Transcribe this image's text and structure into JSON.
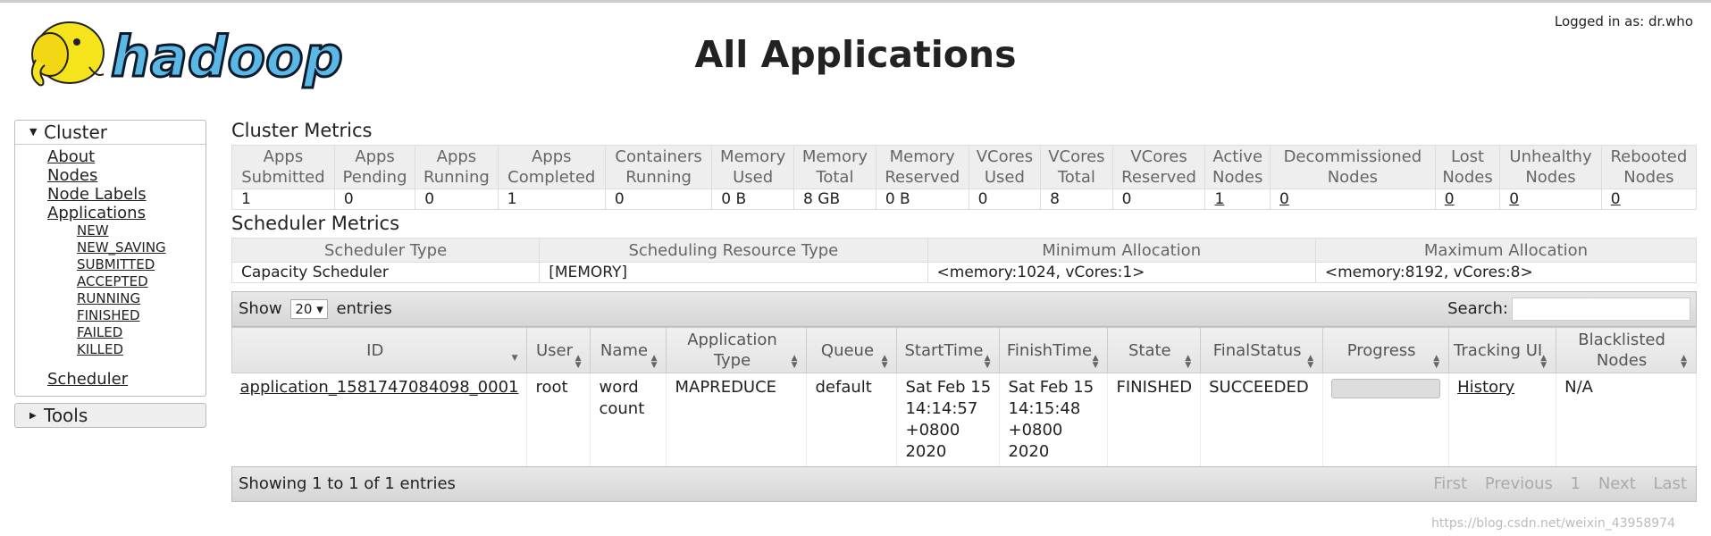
{
  "header": {
    "title": "All Applications",
    "login": "Logged in as: dr.who",
    "logo_text": "hadoop"
  },
  "sidebar": {
    "cluster_label": "Cluster",
    "links": [
      "About",
      "Nodes",
      "Node Labels",
      "Applications"
    ],
    "app_states": [
      "NEW",
      "NEW_SAVING",
      "SUBMITTED",
      "ACCEPTED",
      "RUNNING",
      "FINISHED",
      "FAILED",
      "KILLED"
    ],
    "scheduler": "Scheduler",
    "tools_label": "Tools"
  },
  "cluster_metrics": {
    "title": "Cluster Metrics",
    "headers": [
      [
        "Apps",
        "Submitted"
      ],
      [
        "Apps",
        "Pending"
      ],
      [
        "Apps",
        "Running"
      ],
      [
        "Apps",
        "Completed"
      ],
      [
        "Containers",
        "Running"
      ],
      [
        "Memory",
        "Used"
      ],
      [
        "Memory",
        "Total"
      ],
      [
        "Memory",
        "Reserved"
      ],
      [
        "VCores",
        "Used"
      ],
      [
        "VCores",
        "Total"
      ],
      [
        "VCores",
        "Reserved"
      ],
      [
        "Active",
        "Nodes"
      ],
      [
        "Decommissioned",
        "Nodes"
      ],
      [
        "Lost",
        "Nodes"
      ],
      [
        "Unhealthy",
        "Nodes"
      ],
      [
        "Rebooted",
        "Nodes"
      ]
    ],
    "values": [
      "1",
      "0",
      "0",
      "1",
      "0",
      "0 B",
      "8 GB",
      "0 B",
      "0",
      "8",
      "0",
      "1",
      "0",
      "0",
      "0",
      "0"
    ],
    "linked": [
      false,
      false,
      false,
      false,
      false,
      false,
      false,
      false,
      false,
      false,
      false,
      true,
      true,
      true,
      true,
      true
    ]
  },
  "scheduler_metrics": {
    "title": "Scheduler Metrics",
    "headers": [
      "Scheduler Type",
      "Scheduling Resource Type",
      "Minimum Allocation",
      "Maximum Allocation"
    ],
    "values": [
      "Capacity Scheduler",
      "[MEMORY]",
      "<memory:1024, vCores:1>",
      "<memory:8192, vCores:8>"
    ]
  },
  "apps_table": {
    "show_label": "Show",
    "page_size": "20",
    "entries_label": "entries",
    "search_label": "Search:",
    "search_value": "",
    "columns": [
      [
        "ID"
      ],
      [
        "User"
      ],
      [
        "Name"
      ],
      [
        "Application Type"
      ],
      [
        "Queue"
      ],
      [
        "StartTime"
      ],
      [
        "FinishTime"
      ],
      [
        "State"
      ],
      [
        "FinalStatus"
      ],
      [
        "Progress"
      ],
      [
        "Tracking UI"
      ],
      [
        "Blacklisted",
        "Nodes"
      ]
    ],
    "rows": [
      {
        "id": "application_1581747084098_0001",
        "user": "root",
        "name": "word count",
        "app_type": "MAPREDUCE",
        "queue": "default",
        "start_time": "Sat Feb 15 14:14:57 +0800 2020",
        "finish_time": "Sat Feb 15 14:15:48 +0800 2020",
        "state": "FINISHED",
        "final_status": "SUCCEEDED",
        "progress": 0,
        "tracking_ui": "History",
        "blacklisted_nodes": "N/A"
      }
    ],
    "showing": "Showing 1 to 1 of 1 entries",
    "pager": [
      "First",
      "Previous",
      "1",
      "Next",
      "Last"
    ]
  },
  "watermark": "https://blog.csdn.net/weixin_43958974",
  "colors": {
    "logo_yellow": "#f5e41c",
    "logo_blue": "#5bb8e6",
    "header_bg": "#eeeeee"
  }
}
